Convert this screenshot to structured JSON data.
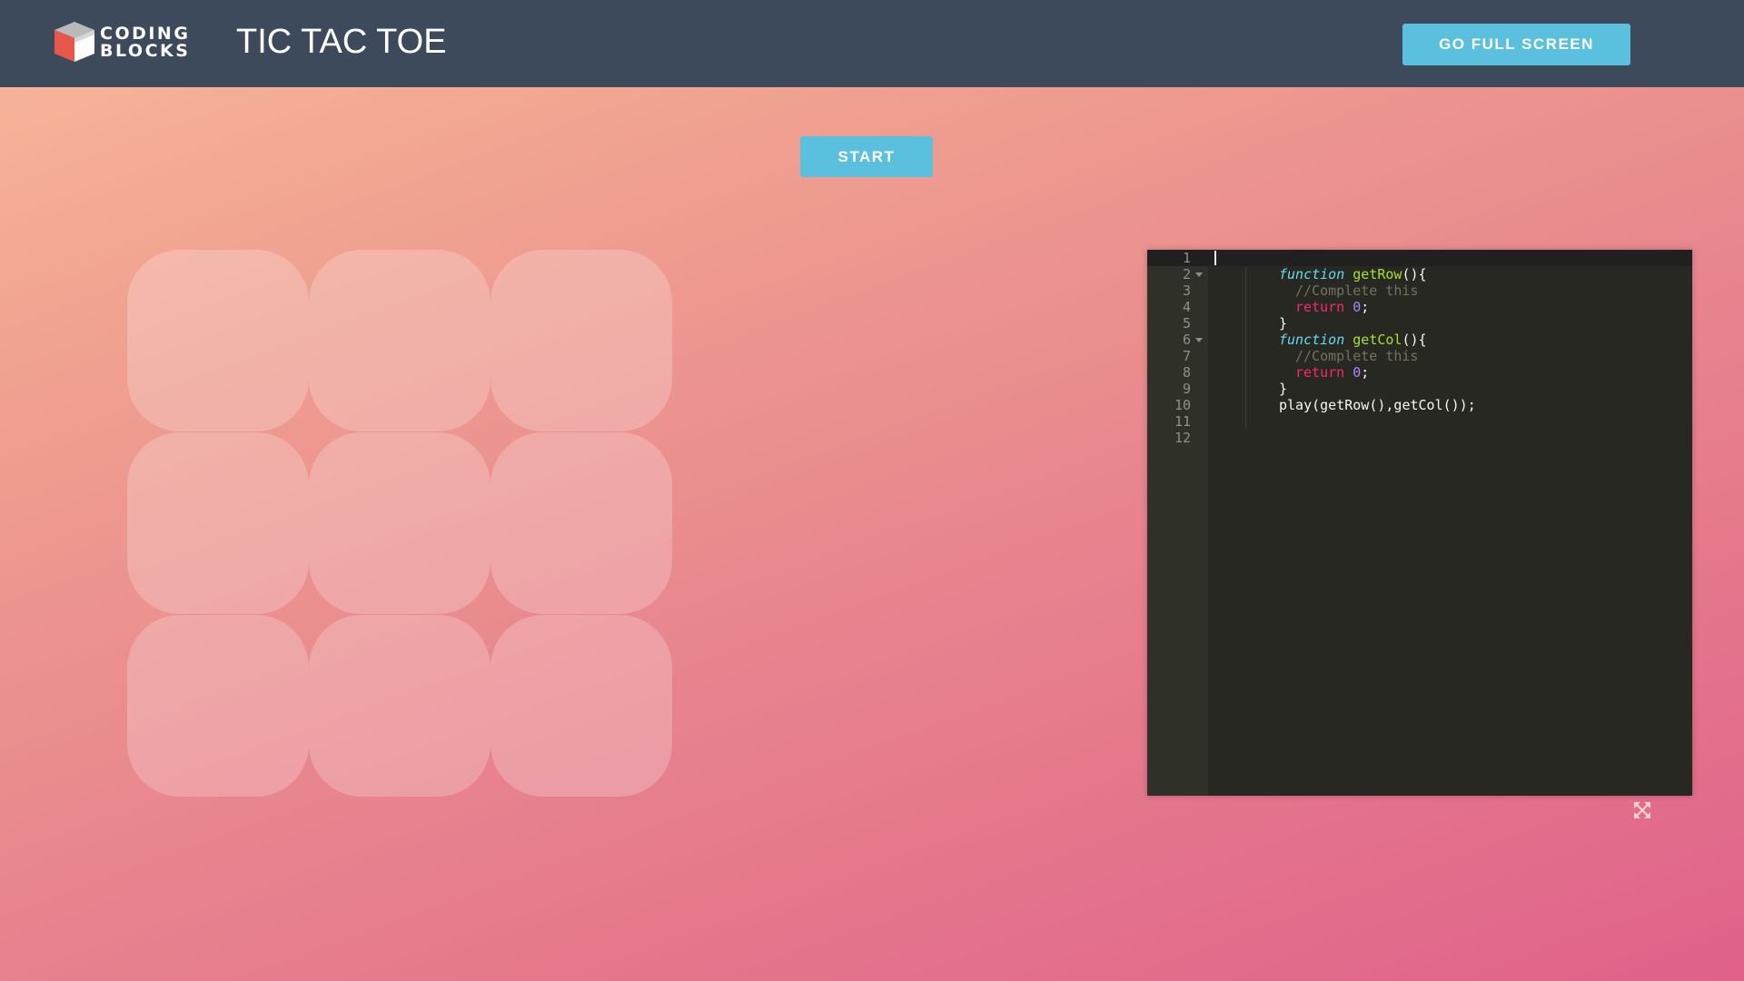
{
  "header": {
    "logo_line1": "CODING",
    "logo_line2": "BLOCKS",
    "title": "TIC TAC TOE",
    "fullscreen_label": "GO FULL SCREEN"
  },
  "controls": {
    "start_label": "START"
  },
  "board": {
    "cells": [
      "",
      "",
      "",
      "",
      "",
      "",
      "",
      "",
      ""
    ]
  },
  "editor": {
    "line_numbers": [
      "1",
      "2",
      "3",
      "4",
      "5",
      "6",
      "7",
      "8",
      "9",
      "10",
      "11",
      "12"
    ],
    "lines": [
      "",
      "function getRow(){",
      "//Complete this",
      "return 0;",
      "}",
      "function getCol(){",
      "//Complete this",
      "return 0;",
      "}",
      "play(getRow(),getCol());",
      "",
      ""
    ]
  },
  "icons": [
    "expand-icon"
  ],
  "colors": {
    "header_bg": "#3c4a5c",
    "button_bg": "#5bc0de",
    "editor_bg": "#272822",
    "gradient_start": "#f8b99a",
    "gradient_end": "#e0628a"
  }
}
